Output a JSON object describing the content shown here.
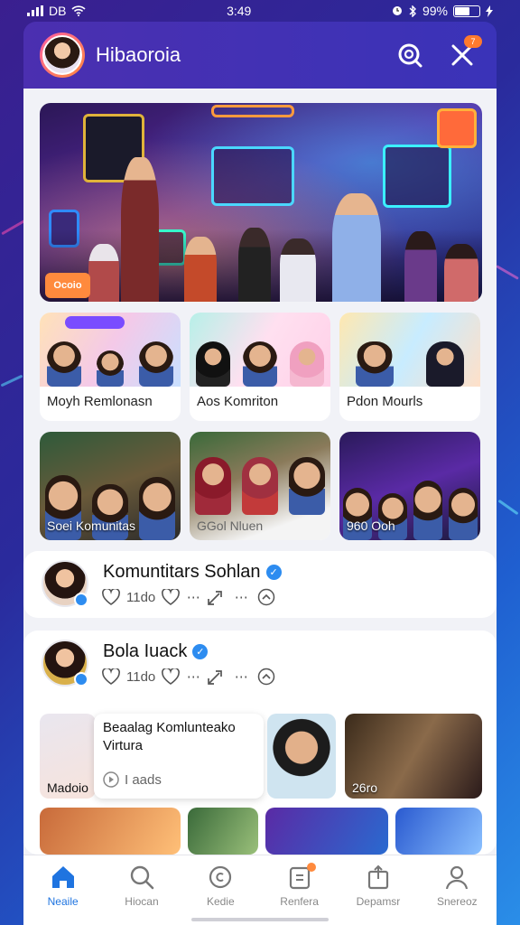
{
  "status_bar": {
    "carrier": "DB",
    "time": "3:49",
    "battery": "99%"
  },
  "header": {
    "title": "Hibaoroia",
    "notification_count": "7"
  },
  "hero": {
    "badge": "Ocoio"
  },
  "grid": [
    {
      "label": "Moyh Remlonasn"
    },
    {
      "label": "Aos Komriton"
    },
    {
      "label": "Pdon Mourls"
    },
    {
      "label": "Soei Komunitas"
    },
    {
      "label": "GGol Nluen"
    },
    {
      "label": "960 Ooh"
    }
  ],
  "posts": [
    {
      "name": "Komuntitars Sohlan",
      "meta": "11do"
    },
    {
      "name": "Bola Iuack",
      "meta": "11do"
    }
  ],
  "media": {
    "left_label": "Madoio",
    "overlay_title": "Beaalag Komlunteako Virtura",
    "overlay_count": "I aads",
    "right_label": "26ro"
  },
  "nav": [
    {
      "label": "Neaile",
      "icon": "home-icon"
    },
    {
      "label": "Hiocan",
      "icon": "search-icon"
    },
    {
      "label": "Kedie",
      "icon": "discover-icon"
    },
    {
      "label": "Renfera",
      "icon": "clipboard-icon"
    },
    {
      "label": "Depamsr",
      "icon": "share-box-icon"
    },
    {
      "label": "Snereoz",
      "icon": "profile-icon"
    }
  ],
  "colors": {
    "accent": "#1f74e0",
    "header": "#4b2fb0",
    "badge": "#ff8a3d",
    "verified": "#2d8cf0"
  }
}
